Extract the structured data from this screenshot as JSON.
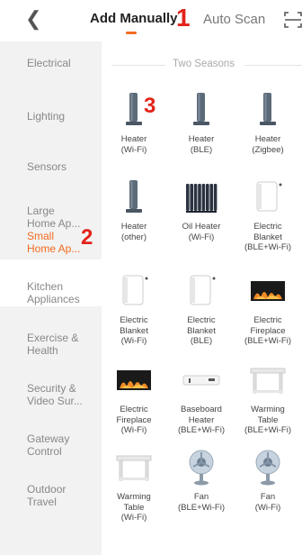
{
  "header": {
    "back_icon": "chevron-left-icon",
    "tab_active": "Add Manually",
    "tab_other": "Auto Scan",
    "scan_icon": "scan-icon",
    "accent": "#f26b21"
  },
  "annotations": {
    "one": "1",
    "two": "2",
    "three": "3",
    "color": "#e2231a"
  },
  "sidebar": {
    "items": [
      {
        "label": "Electrical"
      },
      {
        "label": "Lighting"
      },
      {
        "label": "Sensors"
      },
      {
        "label": "Large\nHome Ap..."
      },
      {
        "label": "Small\nHome Ap...",
        "active": true
      },
      {
        "label": "Kitchen\nAppliances"
      },
      {
        "label": "Exercise &\nHealth"
      },
      {
        "label": "Security &\nVideo Sur..."
      },
      {
        "label": "Gateway\nControl"
      },
      {
        "label": "Outdoor\nTravel"
      }
    ]
  },
  "section": {
    "title": "Two Seasons"
  },
  "devices": [
    {
      "label": "Heater\n(Wi-Fi)",
      "icon": "tower-heater-icon"
    },
    {
      "label": "Heater\n(BLE)",
      "icon": "tower-heater-icon"
    },
    {
      "label": "Heater\n(Zigbee)",
      "icon": "tower-heater-icon"
    },
    {
      "label": "Heater\n(other)",
      "icon": "tower-heater-icon"
    },
    {
      "label": "Oil Heater\n(Wi-Fi)",
      "icon": "oil-heater-icon"
    },
    {
      "label": "Electric\nBlanket\n(BLE+Wi-Fi)",
      "icon": "blanket-controller-icon"
    },
    {
      "label": "Electric\nBlanket\n(Wi-Fi)",
      "icon": "blanket-controller-icon"
    },
    {
      "label": "Electric\nBlanket\n(BLE)",
      "icon": "blanket-controller-icon"
    },
    {
      "label": "Electric\nFireplace\n(BLE+Wi-Fi)",
      "icon": "fireplace-icon"
    },
    {
      "label": "Electric\nFireplace\n(Wi-Fi)",
      "icon": "fireplace-icon"
    },
    {
      "label": "Baseboard\nHeater\n(BLE+Wi-Fi)",
      "icon": "baseboard-heater-icon"
    },
    {
      "label": "Warming\nTable\n(BLE+Wi-Fi)",
      "icon": "warming-table-icon"
    },
    {
      "label": "Warming\nTable\n(Wi-Fi)",
      "icon": "warming-table-icon"
    },
    {
      "label": "Fan\n(BLE+Wi-Fi)",
      "icon": "fan-icon"
    },
    {
      "label": "Fan\n(Wi-Fi)",
      "icon": "fan-icon"
    }
  ]
}
